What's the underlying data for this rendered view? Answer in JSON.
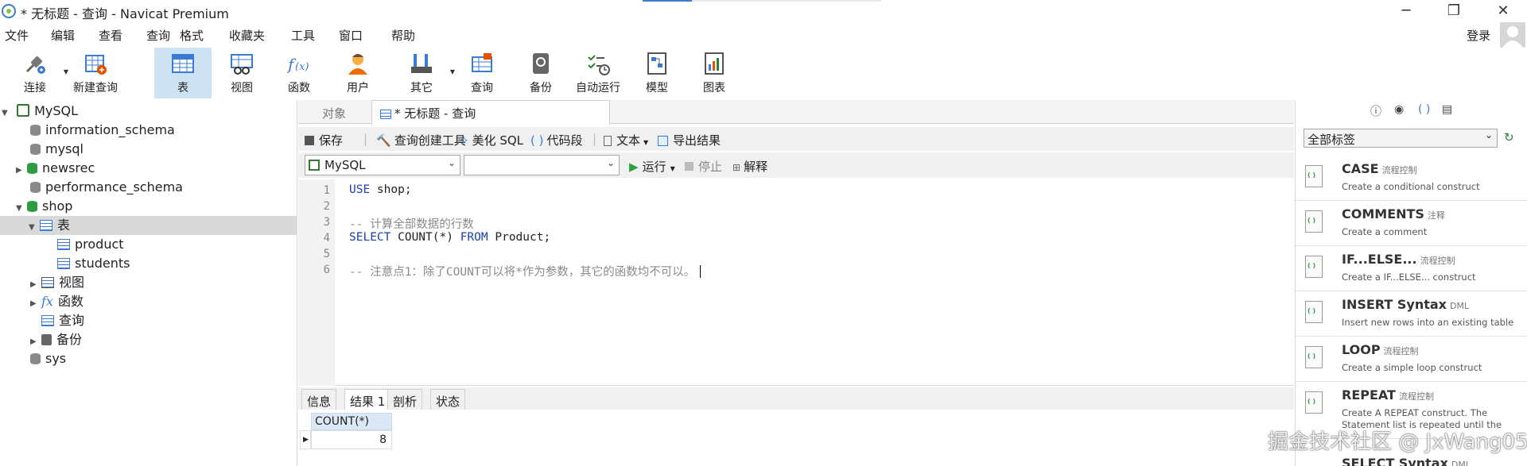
{
  "window": {
    "title": "* 无标题 - 查询 - Navicat Premium",
    "controls": {
      "minimize": "─",
      "maximize": "❐",
      "close": "✕"
    }
  },
  "menu": [
    "文件",
    "编辑",
    "查看",
    "查询",
    "格式",
    "收藏夹",
    "工具",
    "窗口",
    "帮助"
  ],
  "login_label": "登录",
  "toolbar": [
    {
      "label": "连接",
      "icon": "plug-connect-icon"
    },
    {
      "label": "新建查询",
      "icon": "new-query-icon"
    },
    {
      "label": "表",
      "icon": "table-icon",
      "active": true
    },
    {
      "label": "视图",
      "icon": "view-icon"
    },
    {
      "label": "函数",
      "icon": "function-icon"
    },
    {
      "label": "用户",
      "icon": "user-icon"
    },
    {
      "label": "其它",
      "icon": "tools-icon"
    },
    {
      "label": "查询",
      "icon": "query-icon"
    },
    {
      "label": "备份",
      "icon": "backup-icon"
    },
    {
      "label": "自动运行",
      "icon": "schedule-icon"
    },
    {
      "label": "模型",
      "icon": "model-icon"
    },
    {
      "label": "图表",
      "icon": "chart-icon"
    }
  ],
  "tree": {
    "connection": "MySQL",
    "databases": [
      "information_schema",
      "mysql",
      "newsrec",
      "performance_schema",
      "shop",
      "sys"
    ],
    "shop_children": {
      "tables": "表",
      "views": "视图",
      "functions": "函数",
      "queries": "查询",
      "backups": "备份"
    },
    "tables": [
      "product",
      "students"
    ]
  },
  "tabs": {
    "objects": "对象",
    "query": "* 无标题 - 查询"
  },
  "query_toolbar": {
    "save": "保存",
    "builder": "查询创建工具",
    "beautify": "美化 SQL",
    "snippet": "代码段",
    "text": "文本",
    "export": "导出结果"
  },
  "query_toolbar2": {
    "connection_select": "MySQL",
    "database_select": "",
    "run": "运行",
    "stop": "停止",
    "explain": "解释"
  },
  "editor": {
    "line_numbers": [
      "1",
      "2",
      "3",
      "4",
      "5",
      "6"
    ],
    "line1_kw": "USE",
    "line1_rest": " shop;",
    "line3": "-- 计算全部数据的行数",
    "line4_kw1": "SELECT",
    "line4_mid": " COUNT(*) ",
    "line4_kw2": "FROM",
    "line4_rest": " Product;",
    "line6": "-- 注意点1：除了COUNT可以将*作为参数，其它的函数均不可以。"
  },
  "result_tabs": [
    "信息",
    "结果 1",
    "剖析",
    "状态"
  ],
  "result_grid": {
    "column": "COUNT(*)",
    "value": "8",
    "row_marker": "▶"
  },
  "right_panel": {
    "filter": "全部标签",
    "snippets": [
      {
        "name": "CASE",
        "tag": "流程控制",
        "desc": "Create a conditional construct"
      },
      {
        "name": "COMMENTS",
        "tag": "注释",
        "desc": "Create a comment"
      },
      {
        "name": "IF...ELSE...",
        "tag": "流程控制",
        "desc": "Create a IF...ELSE... construct"
      },
      {
        "name": "INSERT Syntax",
        "tag": "DML",
        "desc": "Insert new rows into an existing table"
      },
      {
        "name": "LOOP",
        "tag": "流程控制",
        "desc": "Create a simple loop construct"
      },
      {
        "name": "REPEAT",
        "tag": "流程控制",
        "desc": "Create A REPEAT construct. The Statement list is repeated until the"
      },
      {
        "name": "SELECT Syntax",
        "tag": "DML",
        "desc": ""
      }
    ]
  },
  "watermark": "掘金技术社区 @ JxWang05",
  "colors": {
    "accent": "#3a7bd5",
    "run_green": "#2ea043",
    "active_tool": "#cde3f4"
  }
}
